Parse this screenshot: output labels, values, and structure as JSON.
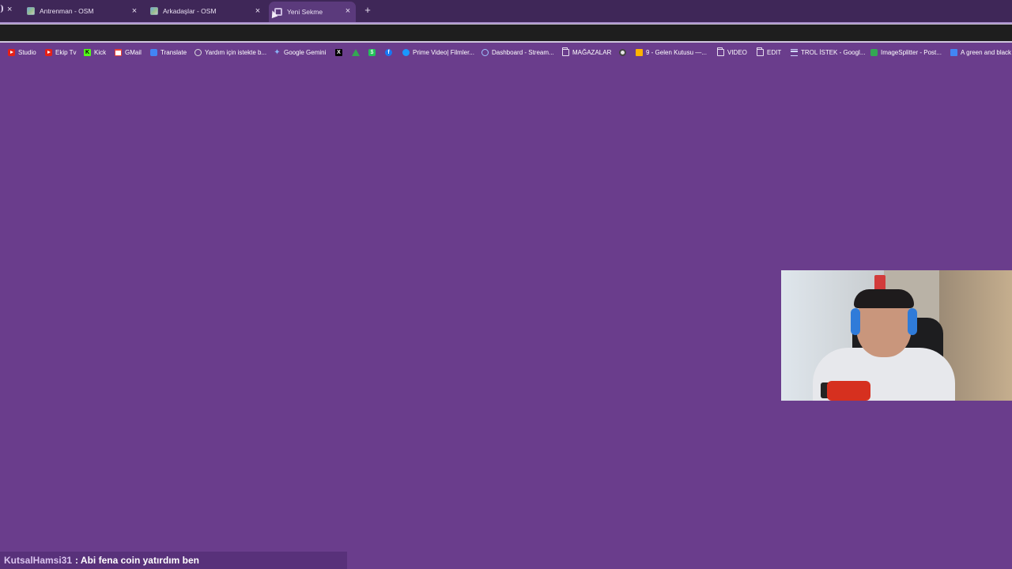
{
  "browser": {
    "tabs": [
      {
        "title": "Antrenman - OSM",
        "icon": "osm-favicon",
        "active": false
      },
      {
        "title": "Arkadaşlar - OSM",
        "icon": "osm-favicon",
        "active": false
      },
      {
        "title": "Yeni Sekme",
        "icon": "chrome-favicon",
        "active": true
      }
    ],
    "tab_close_glyph": "×",
    "new_tab_glyph": "+"
  },
  "bookmarks": [
    {
      "label": "Studio",
      "icon": "youtube-icon"
    },
    {
      "label": "Ekip Tv",
      "icon": "youtube-icon"
    },
    {
      "label": "Kick",
      "icon": "kick-icon"
    },
    {
      "label": "GMail",
      "icon": "gmail-icon"
    },
    {
      "label": "Translate",
      "icon": "translate-icon"
    },
    {
      "label": "Yardım için istekte b...",
      "icon": "globe-icon"
    },
    {
      "label": "Google Gemini",
      "icon": "gemini-icon"
    },
    {
      "label": "",
      "icon": "x-icon"
    },
    {
      "label": "",
      "icon": "drive-icon"
    },
    {
      "label": "",
      "icon": "green-app-icon"
    },
    {
      "label": "",
      "icon": "facebook-icon"
    },
    {
      "label": "Prime Video| Filmler...",
      "icon": "prime-video-icon"
    },
    {
      "label": "Dashboard - Stream...",
      "icon": "dashboard-icon"
    },
    {
      "label": "MAĞAZALAR",
      "icon": "folder-icon"
    },
    {
      "label": "",
      "icon": "world-icon"
    },
    {
      "label": "9 - Gelen Kutusu —...",
      "icon": "mail-icon"
    },
    {
      "label": "VIDEO",
      "icon": "folder-icon"
    },
    {
      "label": "EDIT",
      "icon": "folder-icon"
    },
    {
      "label": "TROL İSTEK - Googl...",
      "icon": "list-icon"
    },
    {
      "label": "ImageSplitter - Post...",
      "icon": "puzzle-icon"
    },
    {
      "label": "A green and black",
      "icon": "doc-icon"
    }
  ],
  "chat": {
    "username": "KutsalHamsi31",
    "message": ": Abi fena coin yatırdım ben"
  },
  "colors": {
    "page_background": "#6a3d8c",
    "tabstrip": "#3f2758",
    "active_tab": "#5b3a7c",
    "chat_background": "#58317a"
  }
}
